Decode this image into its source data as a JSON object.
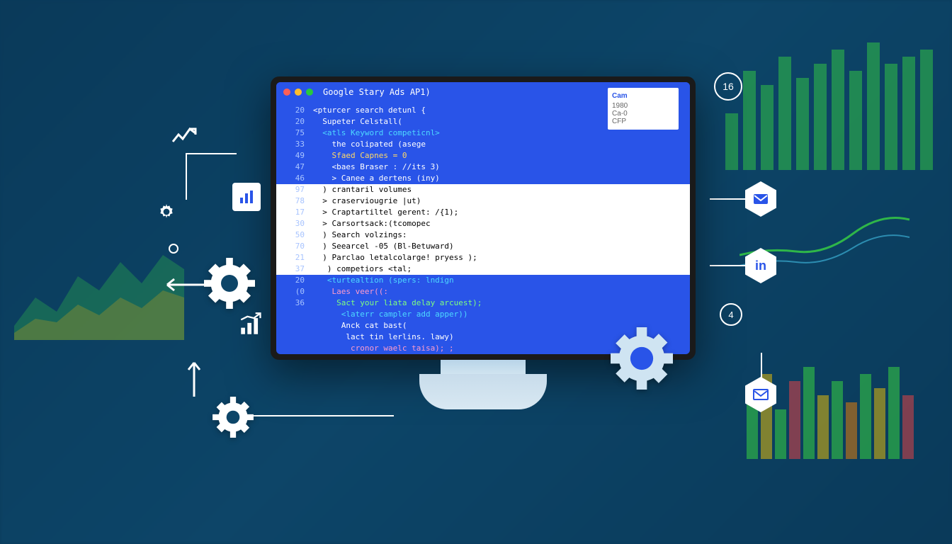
{
  "titlebar": {
    "title": "Google Stary Ads AP1)"
  },
  "info_box": {
    "title": "Cam",
    "row1": "1980",
    "row2": "Ca-0",
    "row3": "CFP"
  },
  "badge_16": "16",
  "badge_4": "4",
  "code": [
    {
      "num": "20",
      "txt": "<pturcer search detunl {",
      "cls": ""
    },
    {
      "num": "20",
      "txt": "  Supeter Celstall(",
      "cls": ""
    },
    {
      "num": "75",
      "txt": "  <atls Keyword competicnl>",
      "cls": "t-cyan"
    },
    {
      "num": "33",
      "txt": "    the colipated (asege",
      "cls": ""
    },
    {
      "num": "49",
      "txt": "    Sfaed Capnes = 0",
      "cls": "t-yellow"
    },
    {
      "num": "47",
      "txt": "    <baes Braser : //its 3)",
      "cls": ""
    },
    {
      "num": "46",
      "txt": "    > Canee a dertens (iny)",
      "cls": ""
    },
    {
      "num": "97",
      "txt": "  ) crantaril volumes",
      "cls": "",
      "white": true
    },
    {
      "num": "78",
      "txt": "  > craserviougrie |ut)",
      "cls": "",
      "white": true
    },
    {
      "num": "17",
      "txt": "  > Craptartiltel gerent: /{1);",
      "cls": "",
      "white": true
    },
    {
      "num": "30",
      "txt": "  > Carsortsack:(tcomopec",
      "cls": "",
      "white": true
    },
    {
      "num": "",
      "txt": "",
      "cls": "",
      "white": true
    },
    {
      "num": "50",
      "txt": "  ) Search volzings:",
      "cls": "",
      "white": true
    },
    {
      "num": "70",
      "txt": "  ) Seearcel -05 (Bl-Betuward)",
      "cls": "",
      "white": true
    },
    {
      "num": "21",
      "txt": "  ) Parclao letalcolarge! pryess );",
      "cls": "",
      "white": true
    },
    {
      "num": "37",
      "txt": "   ) competiors <tal;",
      "cls": "",
      "white": true
    },
    {
      "num": "",
      "txt": "",
      "cls": ""
    },
    {
      "num": "20",
      "txt": "   <turtealtion (spers: lndign",
      "cls": "t-cyan"
    },
    {
      "num": "(0",
      "txt": "    Laes veer((:",
      "cls": "t-pink"
    },
    {
      "num": "36",
      "txt": "     Sact your liata delay arcuest);",
      "cls": "t-green"
    },
    {
      "num": "",
      "txt": "      <laterr campler add apper))",
      "cls": "t-cyan"
    },
    {
      "num": "",
      "txt": "      Anck cat bast(",
      "cls": ""
    },
    {
      "num": "",
      "txt": "       lact tin lerlins. lawy)",
      "cls": ""
    },
    {
      "num": "",
      "txt": "        cronor waelc taisa); ;",
      "cls": "t-pink"
    }
  ]
}
